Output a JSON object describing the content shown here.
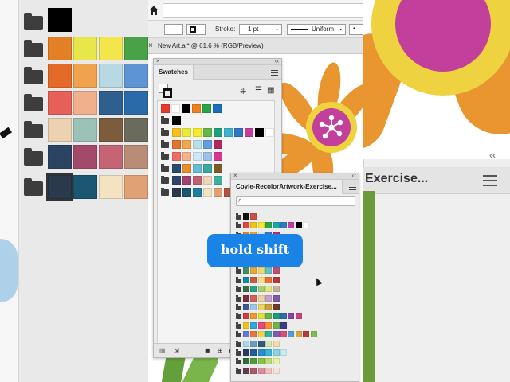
{
  "app": {
    "document_tab": "New Art.ai* @ 61.6 % (RGB/Preview)",
    "stroke_label": "Stroke:",
    "stroke_value": "1 pt",
    "stroke_profile": "Uniform"
  },
  "swatches_panel": {
    "title": "Swatches",
    "rows": [
      [
        "#e53c2c",
        "#ffffff",
        "#000000",
        "#f07f20",
        "#2aa54a",
        "#1c6fbf"
      ],
      [
        "#000000"
      ],
      [
        "#f5c116",
        "#e7ed34",
        "#f6ea2a",
        "#63b84a",
        "#20a07a",
        "#3eb2d1",
        "#2f77c4",
        "#c23f9c",
        "#000000",
        "#ffffff"
      ],
      [
        "#e7742c",
        "#f7a64b",
        "#b8dfea",
        "#5f9fe1",
        "#b12762"
      ],
      [
        "#f06b61",
        "#f7b28b",
        "#cfe7f6",
        "#9ac0ec",
        "#d93590"
      ],
      [
        "#274c6e",
        "#e98d2e",
        "#67bcd5",
        "#3ea6a1",
        "#7b5c27"
      ],
      [
        "#2e456a",
        "#a2446f",
        "#c26071",
        "#f1d3b8",
        "#3bb09a"
      ],
      [
        "#2b394d",
        "#1b5672",
        "#1e7f9f",
        "#f3e3c1",
        "#e0a274",
        "#b2553f",
        "#50a8c1"
      ]
    ]
  },
  "recolor_panel": {
    "title": "Coyle-RecolorArtwork-Exercise...",
    "search_placeholder": "",
    "rows": [
      [
        "#111111",
        "#c8514a"
      ],
      [
        "#e8423a",
        "#f2c21c",
        "#f8e82c",
        "#2fa54a",
        "#18a7a3",
        "#2f7ac5",
        "#c23f9c",
        "#000000",
        "#ffffff"
      ],
      [
        "#e97d2c",
        "#f29d2c",
        "#d8e3ee",
        "#2f77c4",
        "#b92b66"
      ],
      [
        "#274c6e",
        "#e98d2e",
        "#3eb2d1",
        "#2f8f91",
        "#c79a3c"
      ],
      [
        "#f36c60",
        "#f4a36c",
        "#b8e1f1",
        "#7eaee6",
        "#d73489"
      ],
      [
        "#2b3a55",
        "#21809f",
        "#1e9bbd",
        "#f0a44a",
        "#d66a3c"
      ],
      [
        "#3f8f6a",
        "#e9a83a",
        "#f1d96a",
        "#5ec3c6",
        "#c14e70"
      ],
      [
        "#0a8aa9",
        "#c95a3f",
        "#f6df8a",
        "#e8742c",
        "#b13a3c"
      ],
      [
        "#3a6c3f",
        "#2fa08b",
        "#a8d06a",
        "#e2e680",
        "#c3b49a"
      ],
      [
        "#7a2e3b",
        "#d75f59",
        "#ead2a3",
        "#c9a2c9",
        "#7d5aa6"
      ],
      [
        "#3b5a94",
        "#9fc6e6",
        "#e9d65a",
        "#c9a13a",
        "#6b3b27"
      ],
      [
        "#d63a37",
        "#f29b2c",
        "#e5df3a",
        "#6bb548",
        "#1a9e77",
        "#2d6bb5",
        "#85479d",
        "#c7447f"
      ],
      [
        "#f0c21a",
        "#2ba8e0",
        "#e9457f",
        "#f2952d",
        "#70b44b",
        "#3c3c8c"
      ],
      [
        "#5e7bd1",
        "#e7793c",
        "#f1d24a",
        "#2fb3a3",
        "#7e5bb5",
        "#e04a76",
        "#4ea1d6",
        "#e0a33a",
        "#b83c3c",
        "#7cc04e"
      ],
      [
        "#a9d4ea",
        "#6b9fbf",
        "#2f5e7b",
        "#d4e6b5",
        "#f3dab0"
      ],
      [
        "#2a3a66",
        "#1f5f9a",
        "#2f8bd1",
        "#37b6d6",
        "#8ad3e0",
        "#c7ecf2"
      ],
      [
        "#2e6a3a",
        "#4f9a3a",
        "#86c34a",
        "#b9dc76",
        "#e6f0a8"
      ],
      [
        "#6b3b4b",
        "#a85a6b",
        "#d98f9a",
        "#f0c2c0",
        "#f7e2d8"
      ]
    ]
  },
  "caption": "hold shift"
}
